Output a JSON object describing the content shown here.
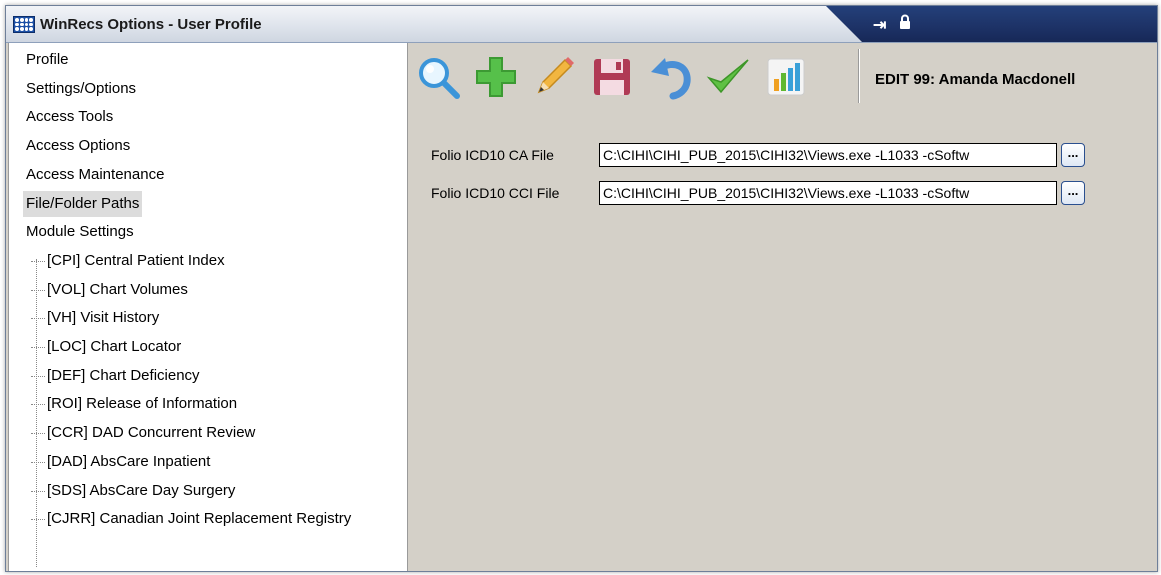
{
  "window": {
    "title": "WinRecs Options - User Profile",
    "icons": [
      "app-grid-icon",
      "pin-icon",
      "lock-icon"
    ]
  },
  "tree": {
    "top_items": [
      {
        "label": "Profile",
        "selected": false
      },
      {
        "label": "Settings/Options",
        "selected": false
      },
      {
        "label": "Access Tools",
        "selected": false
      },
      {
        "label": "Access Options",
        "selected": false
      },
      {
        "label": "Access Maintenance",
        "selected": false
      },
      {
        "label": "File/Folder Paths",
        "selected": true
      },
      {
        "label": "Module Settings",
        "selected": false
      }
    ],
    "module_children": [
      "[CPI] Central Patient Index",
      "[VOL] Chart Volumes",
      "[VH] Visit History",
      "[LOC] Chart Locator",
      "[DEF] Chart Deficiency",
      "[ROI] Release of Information",
      "[CCR] DAD Concurrent Review",
      "[DAD] AbsCare Inpatient",
      "[SDS] AbsCare Day Surgery",
      "[CJRR] Canadian Joint Replacement Registry"
    ]
  },
  "toolbar": {
    "buttons": [
      "search-icon",
      "add-icon",
      "edit-pencil-icon",
      "save-disk-icon",
      "undo-icon",
      "checkmark-icon",
      "report-chart-icon"
    ],
    "edit_label": "EDIT 99: Amanda Macdonell"
  },
  "form": {
    "ca_label": "Folio ICD10 CA File",
    "ca_value": "C:\\CIHI\\CIHI_PUB_2015\\CIHI32\\Views.exe -L1033 -cSoftw",
    "cci_label": "Folio ICD10 CCI File",
    "cci_value": "C:\\CIHI\\CIHI_PUB_2015\\CIHI32\\Views.exe -L1033 -cSoftw",
    "browse_label": "..."
  },
  "colors": {
    "title_dark": "#1d3266",
    "panel_bg": "#d4d0c8",
    "selected_bg": "#dcdcdc"
  }
}
